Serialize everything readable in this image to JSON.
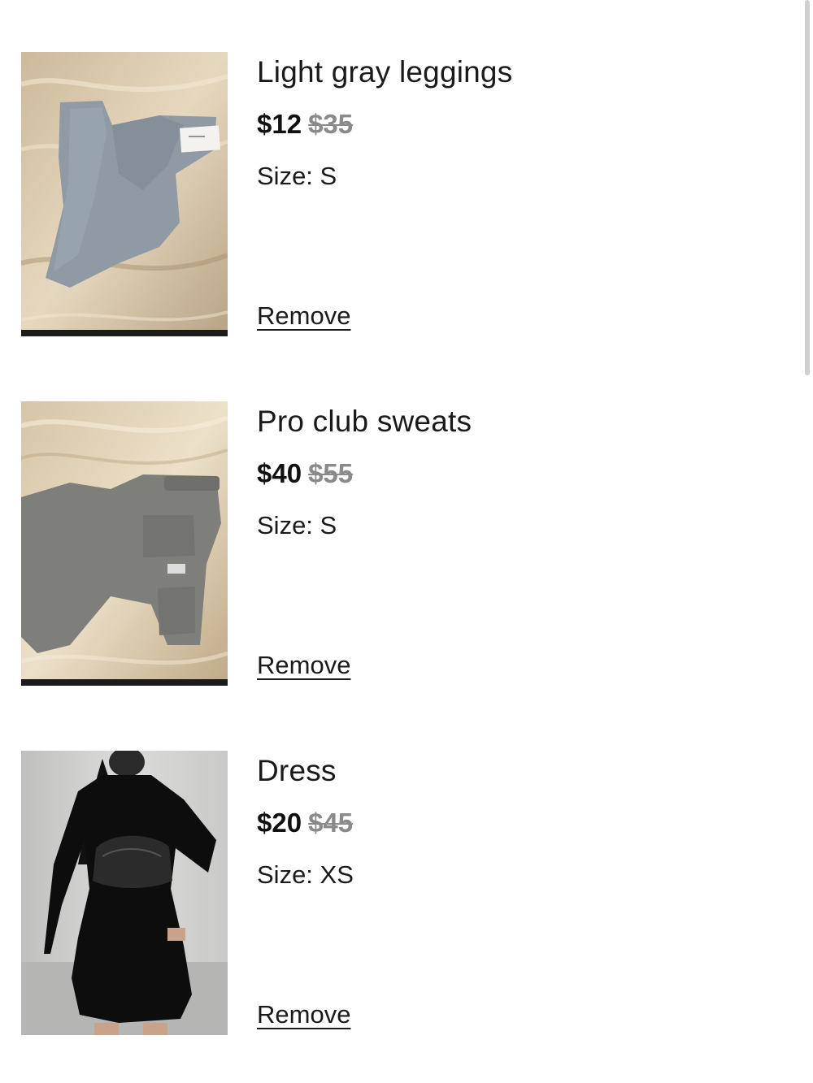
{
  "cart": {
    "items": [
      {
        "title": "Light gray leggings",
        "price": "$12",
        "original_price": "$35",
        "size": "Size: S",
        "remove_label": "Remove"
      },
      {
        "title": "Pro club sweats",
        "price": "$40",
        "original_price": "$55",
        "size": "Size: S",
        "remove_label": "Remove"
      },
      {
        "title": "Dress",
        "price": "$20",
        "original_price": "$45",
        "size": "Size: XS",
        "remove_label": "Remove"
      }
    ]
  },
  "colors": {
    "text": "#1a1a1a",
    "strikethrough_price": "#8a8a8a",
    "background": "#ffffff"
  }
}
